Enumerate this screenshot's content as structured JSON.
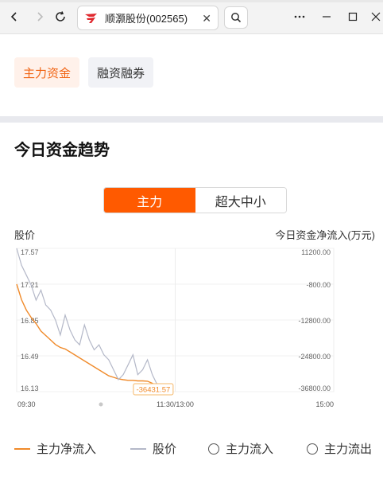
{
  "browser": {
    "tab_title": "顺灏股份(002565)",
    "close_glyph": "✕",
    "icons": [
      "back-icon",
      "forward-icon",
      "refresh-icon",
      "favicon-icon",
      "close-icon",
      "search-icon",
      "more-icon",
      "minimize-icon",
      "maximize-icon",
      "close-window-icon"
    ]
  },
  "tabs": [
    {
      "label": "主力资金",
      "active": true
    },
    {
      "label": "融资融券",
      "active": false
    }
  ],
  "section": {
    "title": "今日资金趋势"
  },
  "toggle": {
    "on": "主力",
    "off": "超大中小"
  },
  "axes": {
    "left_title": "股价",
    "right_title": "今日资金净流入(万元)"
  },
  "colors": {
    "accent": "#ff5a00",
    "flow_line": "#f08a2a",
    "price_line": "#b4b8c8"
  },
  "chart_data": {
    "type": "line",
    "x_ticks": [
      "09:30",
      "11:30/13:00",
      "15:00"
    ],
    "left_axis": {
      "ticks": [
        "17.57",
        "17.21",
        "16.85",
        "16.49",
        "16.13"
      ],
      "range": [
        16.13,
        17.57
      ]
    },
    "right_axis": {
      "ticks": [
        "11200.00",
        "-800.00",
        "-12800.00",
        "-24800.00",
        "-36800.00"
      ],
      "range": [
        -36800,
        11200
      ]
    },
    "current_label": "-36431.57",
    "series": [
      {
        "name": "主力净流入",
        "axis": "right",
        "values": [
          -800,
          -6000,
          -9500,
          -12000,
          -14000,
          -16500,
          -18000,
          -19500,
          -21000,
          -22000,
          -22500,
          -23500,
          -24500,
          -25500,
          -26500,
          -27500,
          -28500,
          -29500,
          -30500,
          -31500,
          -32000,
          -32500,
          -32800,
          -33000,
          -33000,
          -33200,
          -33200,
          -33300,
          -34000,
          -35000,
          -36431.57
        ]
      },
      {
        "name": "股价",
        "axis": "left",
        "values": [
          17.57,
          17.4,
          17.3,
          17.2,
          17.05,
          17.15,
          17.0,
          16.95,
          16.85,
          16.7,
          16.9,
          16.75,
          16.65,
          16.6,
          16.8,
          16.65,
          16.55,
          16.6,
          16.5,
          16.45,
          16.35,
          16.25,
          16.3,
          16.4,
          16.5,
          16.3,
          16.35,
          16.45,
          16.3,
          16.2,
          16.13
        ]
      }
    ],
    "x_points": 31,
    "total_points": 241,
    "grid": true
  },
  "legend": [
    {
      "label": "主力净流入",
      "marker": "line"
    },
    {
      "label": "股价",
      "marker": "line"
    },
    {
      "label": "主力流入",
      "marker": "circle"
    },
    {
      "label": "主力流出",
      "marker": "circle"
    }
  ]
}
